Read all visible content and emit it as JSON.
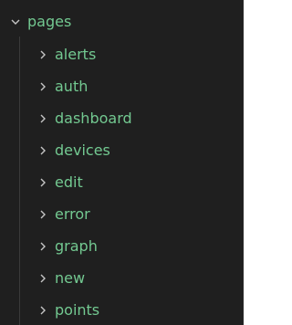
{
  "explorer": {
    "root": {
      "label": "pages",
      "icon": "chevron-down-icon",
      "expanded": true
    },
    "children": [
      {
        "label": "alerts",
        "icon": "chevron-right-icon"
      },
      {
        "label": "auth",
        "icon": "chevron-right-icon"
      },
      {
        "label": "dashboard",
        "icon": "chevron-right-icon"
      },
      {
        "label": "devices",
        "icon": "chevron-right-icon"
      },
      {
        "label": "edit",
        "icon": "chevron-right-icon"
      },
      {
        "label": "error",
        "icon": "chevron-right-icon"
      },
      {
        "label": "graph",
        "icon": "chevron-right-icon"
      },
      {
        "label": "new",
        "icon": "chevron-right-icon"
      },
      {
        "label": "points",
        "icon": "chevron-right-icon"
      }
    ]
  },
  "colors": {
    "background": "#1f1f1f",
    "text": "#73c991",
    "chevron": "#c5c5c5",
    "indent_guide": "#3a3a3a"
  }
}
